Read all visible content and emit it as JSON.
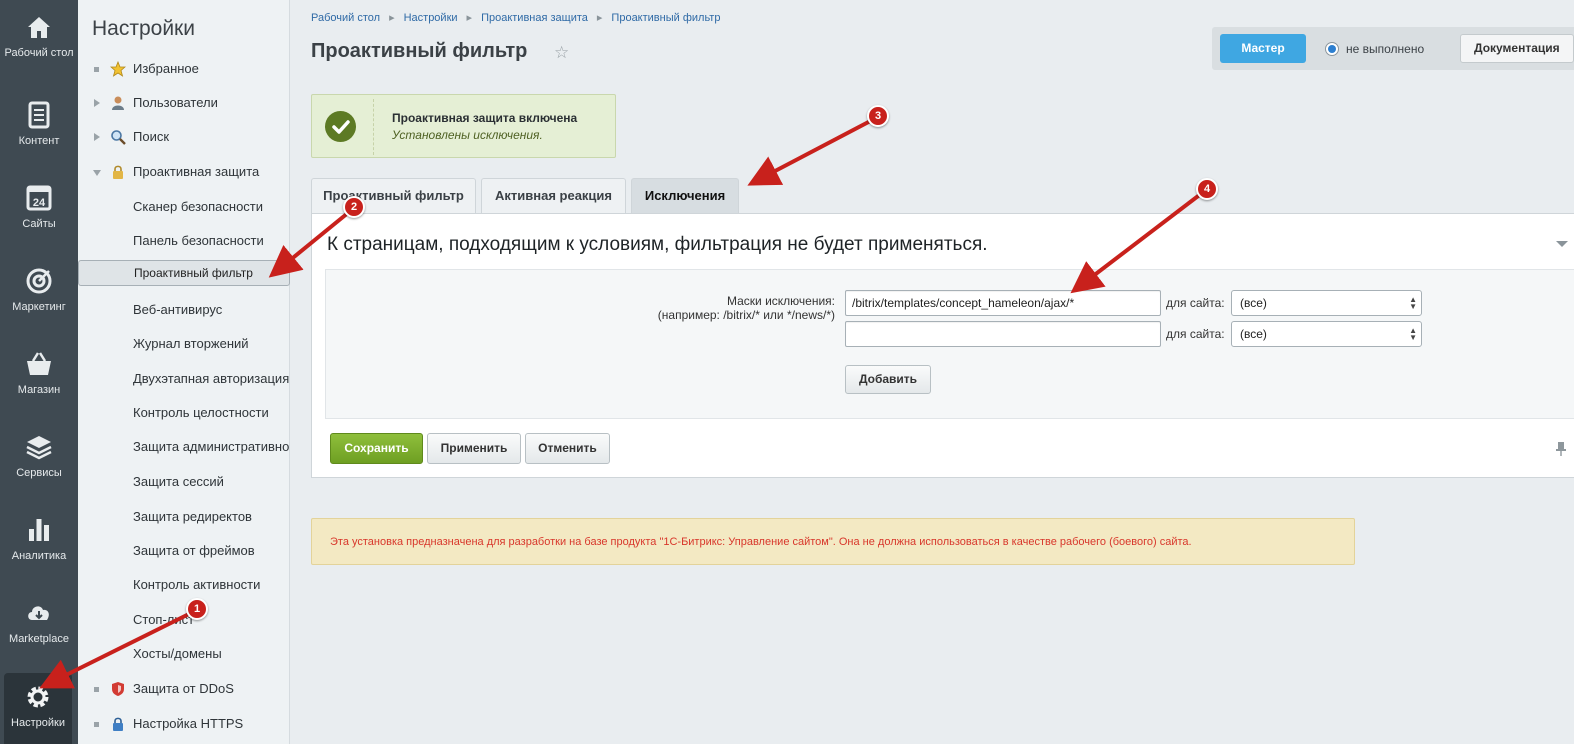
{
  "nav": {
    "items": [
      {
        "label": "Рабочий стол",
        "icon": "home-icon"
      },
      {
        "label": "Контент",
        "icon": "document-icon"
      },
      {
        "label": "Сайты",
        "icon": "calendar-icon",
        "badge": "24"
      },
      {
        "label": "Маркетинг",
        "icon": "target-icon"
      },
      {
        "label": "Магазин",
        "icon": "basket-icon"
      },
      {
        "label": "Сервисы",
        "icon": "layers-icon"
      },
      {
        "label": "Аналитика",
        "icon": "bar-chart-icon"
      },
      {
        "label": "Marketplace",
        "icon": "cloud-download-icon"
      },
      {
        "label": "Настройки",
        "icon": "gear-icon",
        "active": true
      }
    ]
  },
  "menu": {
    "title": "Настройки",
    "items": [
      {
        "label": "Избранное",
        "icon": "star-icon"
      },
      {
        "label": "Пользователи",
        "icon": "user-icon"
      },
      {
        "label": "Поиск",
        "icon": "magnifier-icon"
      },
      {
        "label": "Проактивная защита",
        "icon": "lock-icon"
      },
      {
        "label": "Сканер безопасности"
      },
      {
        "label": "Панель безопасности"
      },
      {
        "label": "Проактивный фильтр",
        "selected": true
      },
      {
        "label": "Веб-антивирус"
      },
      {
        "label": "Журнал вторжений"
      },
      {
        "label": "Двухэтапная авторизация"
      },
      {
        "label": "Контроль целостности"
      },
      {
        "label": "Защита административной"
      },
      {
        "label": "Защита сессий"
      },
      {
        "label": "Защита редиректов"
      },
      {
        "label": "Защита от фреймов"
      },
      {
        "label": "Контроль активности"
      },
      {
        "label": "Стоп-лист"
      },
      {
        "label": "Хосты/домены"
      },
      {
        "label": "Защита от DDoS",
        "icon": "shield-icon"
      },
      {
        "label": "Настройка HTTPS",
        "icon": "padlock-icon"
      }
    ]
  },
  "breadcrumb": [
    "Рабочий стол",
    "Настройки",
    "Проактивная защита",
    "Проактивный фильтр"
  ],
  "page": {
    "title": "Проактивный фильтр"
  },
  "topbar": {
    "master_label": "Мастер",
    "master_status": "не выполнено",
    "docs_label": "Документация"
  },
  "notice": {
    "title": "Проактивная защита включена",
    "text": "Установлены исключения."
  },
  "tabs": [
    {
      "label": "Проактивный фильтр"
    },
    {
      "label": "Активная реакция"
    },
    {
      "label": "Исключения",
      "active": true
    }
  ],
  "panel": {
    "heading": "К страницам, подходящим к условиям, фильтрация не будет применяться.",
    "mask_label": "Маски исключения:",
    "mask_hint": "(например: /bitrix/* или */news/*)",
    "rows": [
      {
        "value": "/bitrix/templates/concept_hameleon/ajax/*",
        "site_label": "для сайта:",
        "site_value": "(все)"
      },
      {
        "value": "",
        "site_label": "для сайта:",
        "site_value": "(все)"
      }
    ],
    "add_label": "Добавить"
  },
  "actions": {
    "save": "Сохранить",
    "apply": "Применить",
    "cancel": "Отменить"
  },
  "warning": "Эта установка предназначена для разработки на базе продукта \"1С-Битрикс: Управление сайтом\". Она не должна использоваться в качестве рабочего (боевого) сайта.",
  "annotations": [
    "1",
    "2",
    "3",
    "4"
  ],
  "colors": {
    "accent_blue": "#3fa7e2",
    "save_green": "#7aab2b",
    "annotation_red": "#c8211c",
    "warning_text": "#d8372b"
  }
}
